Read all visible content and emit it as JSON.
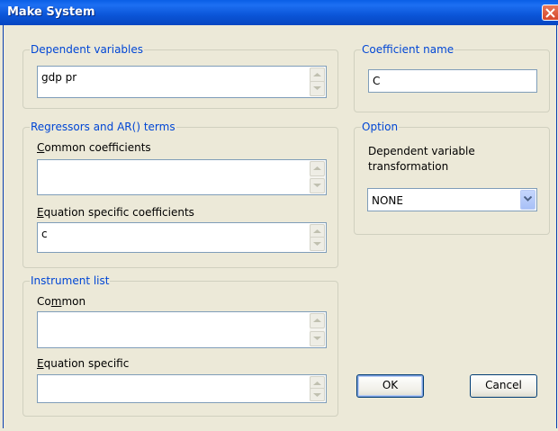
{
  "window": {
    "title": "Make System"
  },
  "groups": {
    "dependent": {
      "legend": "Dependent variables",
      "value": "gdp pr"
    },
    "coefficient": {
      "legend": "Coefficient name",
      "value": "C"
    },
    "regressors": {
      "legend": "Regressors and AR() terms",
      "common_label_ul": "C",
      "common_label_rest": "ommon coefficients",
      "common_value": "",
      "specific_label_ul": "E",
      "specific_label_rest": "quation specific coefficients",
      "specific_value": "c"
    },
    "option": {
      "legend": "Option",
      "label_line1": "Dependent variable",
      "label_line2": "transformation",
      "selected": "NONE"
    },
    "instruments": {
      "legend": "Instrument list",
      "common_pre": "Co",
      "common_ul": "m",
      "common_post": "mon",
      "common_value": "",
      "specific_ul": "E",
      "specific_rest": "quation specific",
      "specific_value": ""
    }
  },
  "buttons": {
    "ok": "OK",
    "cancel": "Cancel"
  },
  "colors": {
    "titlebar": "#0a5fe6",
    "legend": "#0046d5",
    "face": "#ece9d8"
  }
}
